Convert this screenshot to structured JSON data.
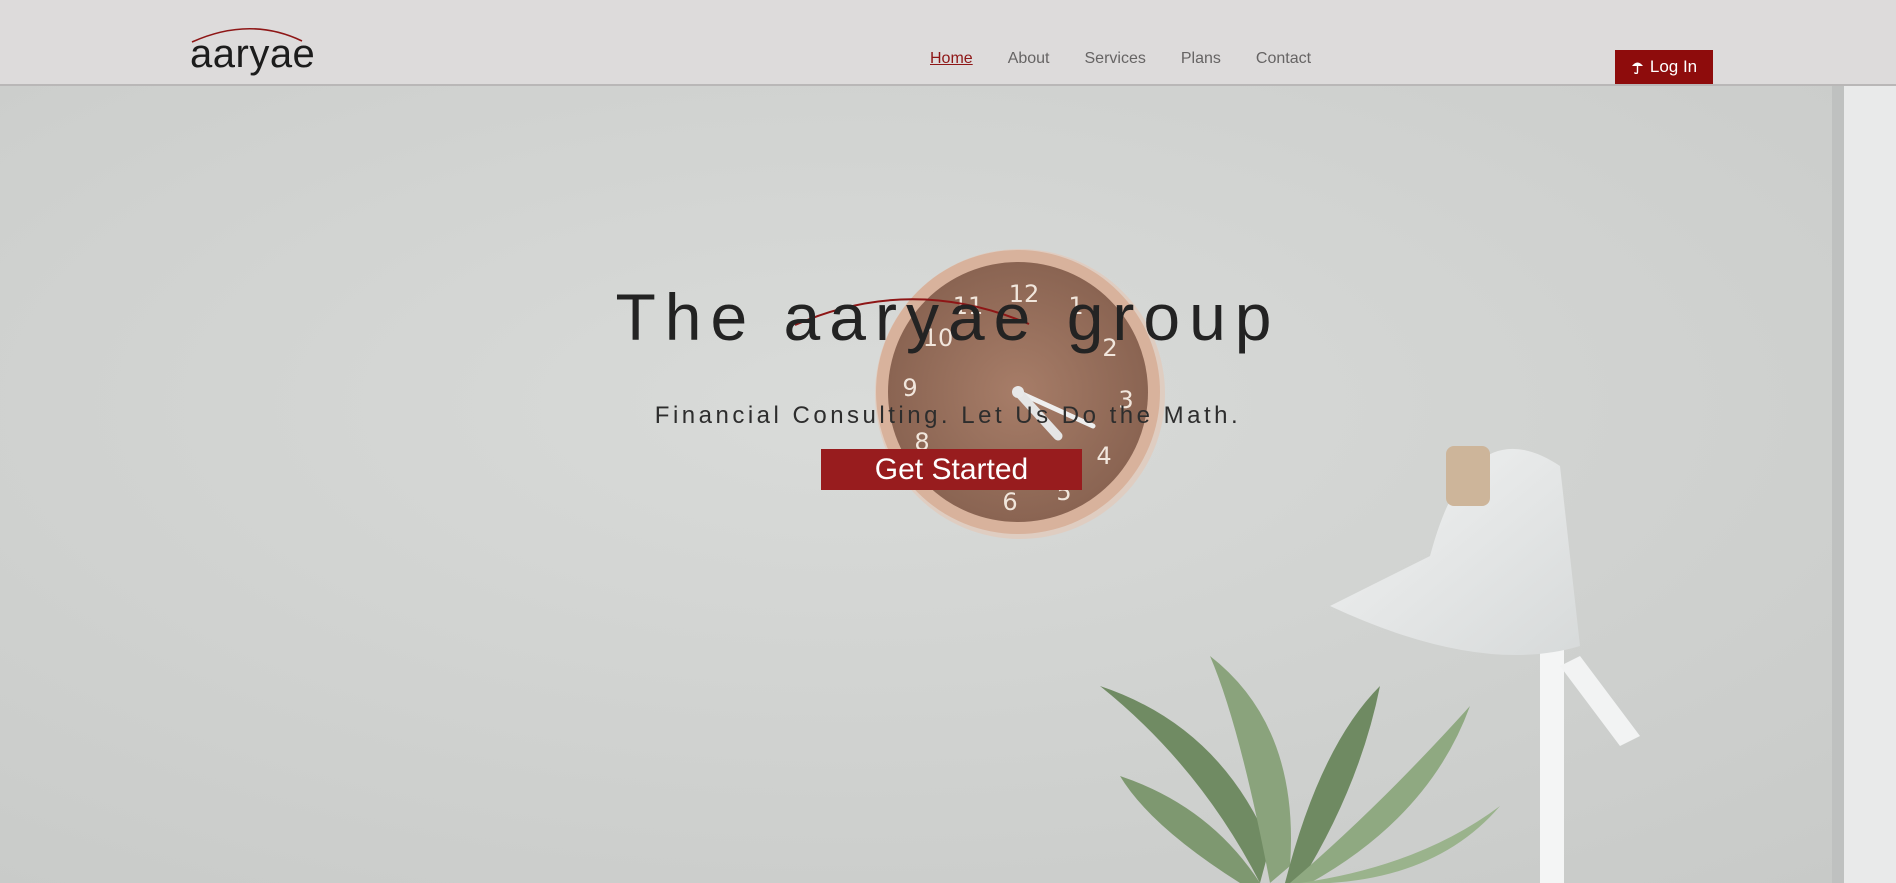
{
  "header": {
    "logo_text": "aaryae",
    "nav": [
      {
        "label": "Home",
        "active": true
      },
      {
        "label": "About",
        "active": false
      },
      {
        "label": "Services",
        "active": false
      },
      {
        "label": "Plans",
        "active": false
      },
      {
        "label": "Contact",
        "active": false
      }
    ],
    "login_label": "Log In",
    "login_icon": "umbrella-icon"
  },
  "hero": {
    "title": "The aaryae group",
    "subtitle": "Financial Consulting. Let Us Do the Math.",
    "cta_label": "Get Started",
    "background": "wall-clock-plant-lamp-photo"
  },
  "colors": {
    "accent": "#8e0c0c",
    "cta": "#981c1e",
    "header_bg": "#dddbdb",
    "nav_text": "#666464",
    "hero_bg": "#d1d3d1"
  }
}
